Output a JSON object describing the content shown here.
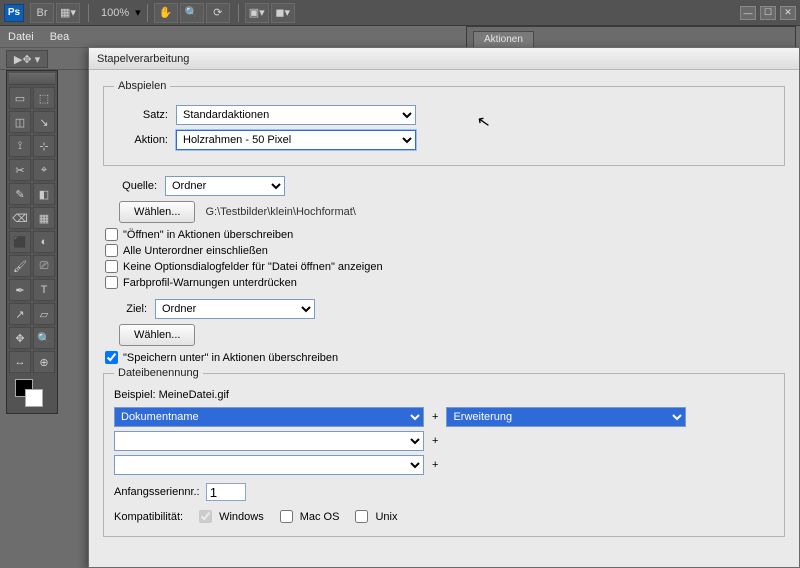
{
  "topbar": {
    "logo": "Ps",
    "zoom": "100%",
    "pan_btn": "✋",
    "zoom_btn": "🔍",
    "rotate_btn": "⟳"
  },
  "menubar": {
    "items": [
      "Datei",
      "Bea"
    ]
  },
  "actions_panel": {
    "tab": "Aktionen",
    "collapse": "◀◀",
    "close": "✕"
  },
  "dialog": {
    "title": "Stapelverarbeitung",
    "play_legend": "Abspielen",
    "satz_label": "Satz:",
    "satz_value": "Standardaktionen",
    "aktion_label": "Aktion:",
    "aktion_value": "Holzrahmen - 50 Pixel",
    "quelle_label": "Quelle:",
    "quelle_value": "Ordner",
    "choose_btn": "Wählen...",
    "source_path": "G:\\Testbilder\\klein\\Hochformat\\",
    "chk_open": "\"Öffnen\" in Aktionen überschreiben",
    "chk_sub": "Alle Unterordner einschließen",
    "chk_dlg": "Keine Optionsdialogfelder für \"Datei öffnen\" anzeigen",
    "chk_color": "Farbprofil-Warnungen unterdrücken",
    "ziel_label": "Ziel:",
    "ziel_value": "Ordner",
    "chk_save": "\"Speichern unter\" in Aktionen überschreiben",
    "naming_legend": "Dateibenennung",
    "example_label": "Beispiel:",
    "example_value": "MeineDatei.gif",
    "name_token1": "Dokumentname",
    "name_token2": "Erweiterung",
    "plus": "+",
    "startnum_label": "Anfangsseriennr.:",
    "startnum_value": "1",
    "compat_label": "Kompatibilität:",
    "compat_win": "Windows",
    "compat_mac": "Mac OS",
    "compat_unix": "Unix"
  },
  "tools_icons": [
    "▭",
    "⬚",
    "◫",
    "↘",
    "⟟",
    "⊹",
    "✂",
    "⌖",
    "✎",
    "◧",
    "⌫",
    "▦",
    "⬛",
    "◐",
    "🖌",
    "⎚",
    "✒",
    "T",
    "↗",
    "▱",
    "✥",
    "🔍",
    "↔",
    "⊕"
  ]
}
